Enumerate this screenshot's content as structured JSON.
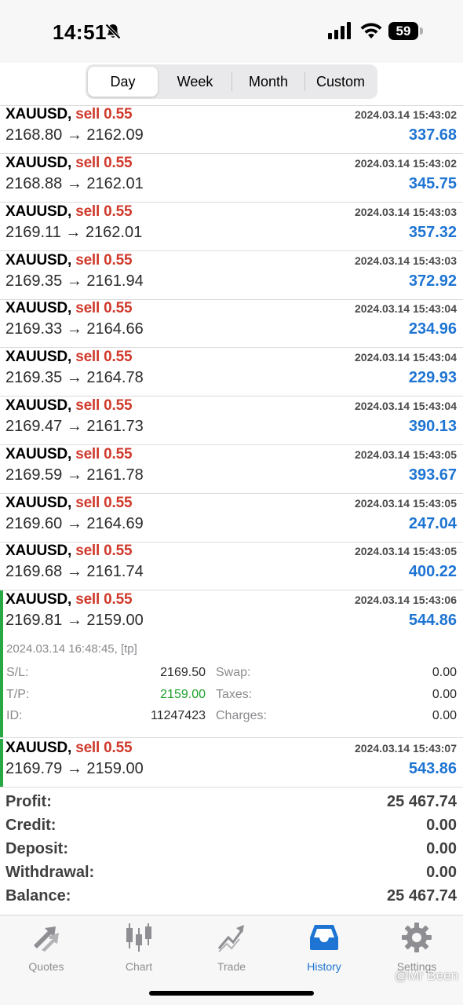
{
  "status_bar": {
    "time": "14:51",
    "battery": "59"
  },
  "period_tabs": [
    {
      "label": "Day",
      "active": true
    },
    {
      "label": "Week",
      "active": false
    },
    {
      "label": "Month",
      "active": false
    },
    {
      "label": "Custom",
      "active": false
    }
  ],
  "deals": [
    {
      "symbol": "XAUUSD,",
      "type": "sell 0.55",
      "date": "2024.03.14 15:43:02",
      "prices": "2168.80 → 2162.09",
      "profit": "337.68"
    },
    {
      "symbol": "XAUUSD,",
      "type": "sell 0.55",
      "date": "2024.03.14 15:43:02",
      "prices": "2168.88 → 2162.01",
      "profit": "345.75"
    },
    {
      "symbol": "XAUUSD,",
      "type": "sell 0.55",
      "date": "2024.03.14 15:43:03",
      "prices": "2169.11 → 2162.01",
      "profit": "357.32"
    },
    {
      "symbol": "XAUUSD,",
      "type": "sell 0.55",
      "date": "2024.03.14 15:43:03",
      "prices": "2169.35 → 2161.94",
      "profit": "372.92"
    },
    {
      "symbol": "XAUUSD,",
      "type": "sell 0.55",
      "date": "2024.03.14 15:43:04",
      "prices": "2169.33 → 2164.66",
      "profit": "234.96"
    },
    {
      "symbol": "XAUUSD,",
      "type": "sell 0.55",
      "date": "2024.03.14 15:43:04",
      "prices": "2169.35 → 2164.78",
      "profit": "229.93"
    },
    {
      "symbol": "XAUUSD,",
      "type": "sell 0.55",
      "date": "2024.03.14 15:43:04",
      "prices": "2169.47 → 2161.73",
      "profit": "390.13"
    },
    {
      "symbol": "XAUUSD,",
      "type": "sell 0.55",
      "date": "2024.03.14 15:43:05",
      "prices": "2169.59 → 2161.78",
      "profit": "393.67"
    },
    {
      "symbol": "XAUUSD,",
      "type": "sell 0.55",
      "date": "2024.03.14 15:43:05",
      "prices": "2169.60 → 2164.69",
      "profit": "247.04"
    },
    {
      "symbol": "XAUUSD,",
      "type": "sell 0.55",
      "date": "2024.03.14 15:43:05",
      "prices": "2169.68 → 2161.74",
      "profit": "400.22"
    },
    {
      "symbol": "XAUUSD,",
      "type": "sell 0.55",
      "date": "2024.03.14 15:43:06",
      "prices": "2169.81 → 2159.00",
      "profit": "544.86"
    },
    {
      "symbol": "XAUUSD,",
      "type": "sell 0.55",
      "date": "2024.03.14 15:43:07",
      "prices": "2169.79 → 2159.00",
      "profit": "543.86"
    }
  ],
  "expanded_detail": {
    "closed": "2024.03.14 16:48:45, [tp]",
    "sl_label": "S/L:",
    "sl": "2169.50",
    "tp_label": "T/P:",
    "tp": "2159.00",
    "id_label": "ID:",
    "id": "11247423",
    "swap_label": "Swap:",
    "swap": "0.00",
    "taxes_label": "Taxes:",
    "taxes": "0.00",
    "charges_label": "Charges:",
    "charges": "0.00"
  },
  "summary": [
    {
      "label": "Profit:",
      "value": "25 467.74"
    },
    {
      "label": "Credit:",
      "value": "0.00"
    },
    {
      "label": "Deposit:",
      "value": "0.00"
    },
    {
      "label": "Withdrawal:",
      "value": "0.00"
    },
    {
      "label": "Balance:",
      "value": "25 467.74"
    }
  ],
  "tabbar": [
    {
      "label": "Quotes",
      "icon": "quotes-arrows-icon",
      "active": false
    },
    {
      "label": "Chart",
      "icon": "candlestick-chart-icon",
      "active": false
    },
    {
      "label": "Trade",
      "icon": "trade-line-icon",
      "active": false
    },
    {
      "label": "History",
      "icon": "history-inbox-icon",
      "active": true
    },
    {
      "label": "Settings",
      "icon": "gear-icon",
      "active": false
    }
  ],
  "watermark": "@Mr Been",
  "colors": {
    "accent": "#1e74d2",
    "sell": "#d0392b",
    "tp_green": "#22a12c",
    "selected_bar": "#27a845"
  }
}
